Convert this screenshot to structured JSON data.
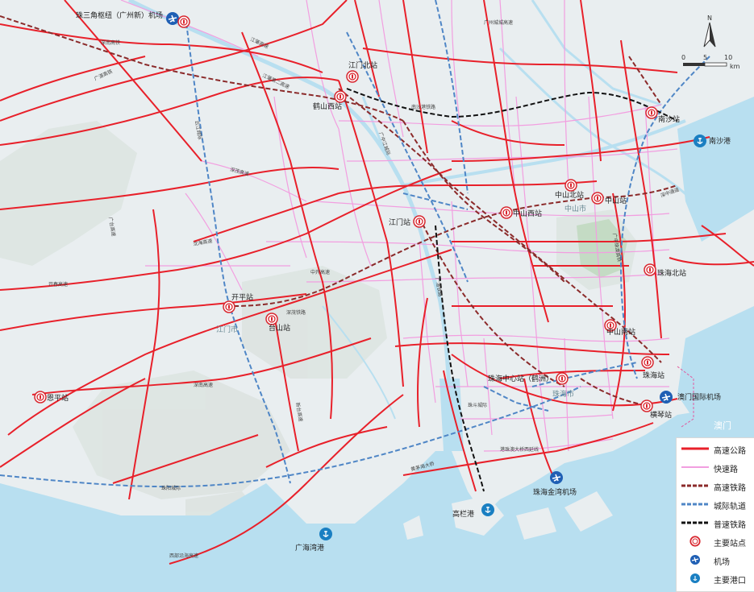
{
  "map": {
    "cities": [
      "江门市",
      "中山市",
      "珠海市",
      "澳门"
    ],
    "stations": [
      {
        "name": "珠三角枢纽（广州新）机场"
      },
      {
        "name": "江门北站"
      },
      {
        "name": "鹤山西站"
      },
      {
        "name": "南沙站"
      },
      {
        "name": "南沙港"
      },
      {
        "name": "中山北站"
      },
      {
        "name": "中山站"
      },
      {
        "name": "江门站"
      },
      {
        "name": "中山西站"
      },
      {
        "name": "珠海北站"
      },
      {
        "name": "开平站"
      },
      {
        "name": "台山站"
      },
      {
        "name": "中山南站"
      },
      {
        "name": "珠海站"
      },
      {
        "name": "珠海中心站（鹤洲）"
      },
      {
        "name": "澳门国际机场"
      },
      {
        "name": "横琴站"
      },
      {
        "name": "恩平站"
      },
      {
        "name": "珠海金湾机场"
      },
      {
        "name": "高栏港"
      },
      {
        "name": "广海湾港"
      }
    ],
    "road_labels": [
      "深南高铁",
      "广湛高铁",
      "江肇高速",
      "江肇第二高速",
      "云江城际",
      "广台高速",
      "深茂高速",
      "沈海高速",
      "开春高速",
      "深茂铁路",
      "中开高速",
      "新台高速",
      "深南高速",
      "珠阳城际",
      "西部沿海高速",
      "广湛铁路",
      "黄茅海大桥",
      "港珠澳大桥西延线",
      "南沙港铁路",
      "广中江城际",
      "广中珠澳高铁",
      "珠斗城际",
      "深中通道",
      "广州城城高速",
      "中开高速"
    ],
    "scale": {
      "north": "N",
      "ticks": [
        "0",
        "5",
        "10"
      ],
      "unit": "km"
    }
  },
  "legend": {
    "items": [
      {
        "label": "高速公路",
        "symbol": "expressway"
      },
      {
        "label": "快速路",
        "symbol": "fast-road"
      },
      {
        "label": "高速铁路",
        "symbol": "high-speed-rail"
      },
      {
        "label": "城际轨道",
        "symbol": "intercity-rail"
      },
      {
        "label": "普速铁路",
        "symbol": "normal-rail"
      },
      {
        "label": "主要站点",
        "symbol": "station-icon"
      },
      {
        "label": "机场",
        "symbol": "airport-icon"
      },
      {
        "label": "主要港口",
        "symbol": "port-icon"
      }
    ]
  },
  "colors": {
    "expressway": "#e8202a",
    "fast_road": "#f29ee0",
    "high_speed_rail": "#8b2a2a",
    "intercity_rail": "#4f86c6",
    "normal_rail": "#111111",
    "sea": "#b8dff0",
    "land": "#e9eef0"
  }
}
